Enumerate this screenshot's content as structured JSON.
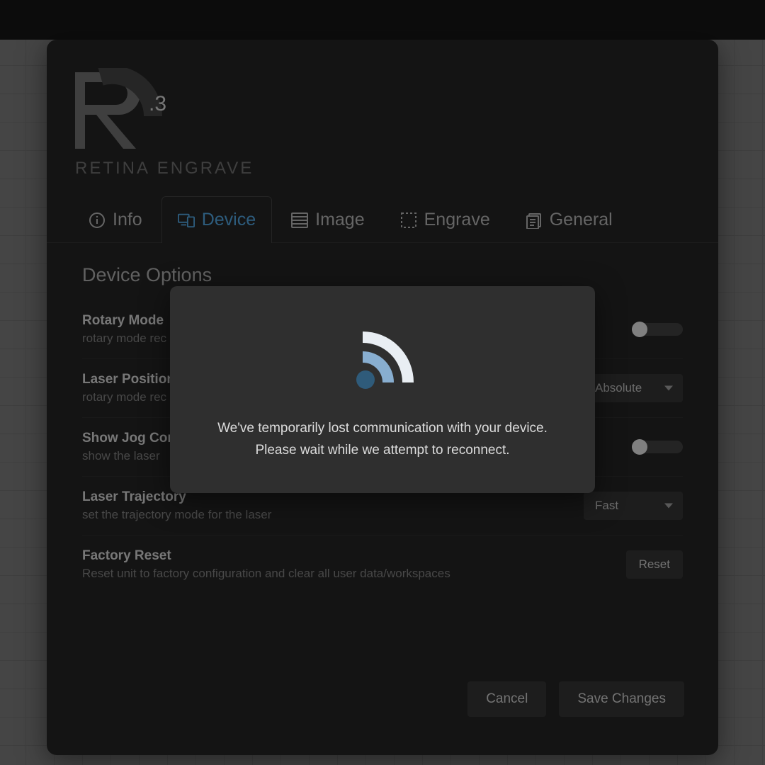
{
  "brand": {
    "name_strong": "RETINA",
    "name_light": "ENGRAVE",
    "version_suffix": ".3"
  },
  "tabs": {
    "info": {
      "label": "Info"
    },
    "device": {
      "label": "Device"
    },
    "image": {
      "label": "Image"
    },
    "engrave": {
      "label": "Engrave"
    },
    "general": {
      "label": "General"
    }
  },
  "section": {
    "title": "Device Options",
    "rotary": {
      "title": "Rotary Mode",
      "desc": "rotary mode rec"
    },
    "position": {
      "title": "Laser Position",
      "desc": "rotary mode rec",
      "value": "Absolute"
    },
    "jog": {
      "title": "Show Jog Controls",
      "desc": "show the laser"
    },
    "trajectory": {
      "title": "Laser Trajectory",
      "desc": "set the trajectory mode for the laser",
      "value": "Fast"
    },
    "reset": {
      "title": "Factory Reset",
      "desc": "Reset unit to factory configuration and clear all user data/workspaces",
      "button": "Reset"
    }
  },
  "footer": {
    "cancel": "Cancel",
    "save": "Save Changes"
  },
  "modal": {
    "line1": "We've temporarily lost communication with your device.",
    "line2": "Please wait while we attempt to reconnect."
  }
}
